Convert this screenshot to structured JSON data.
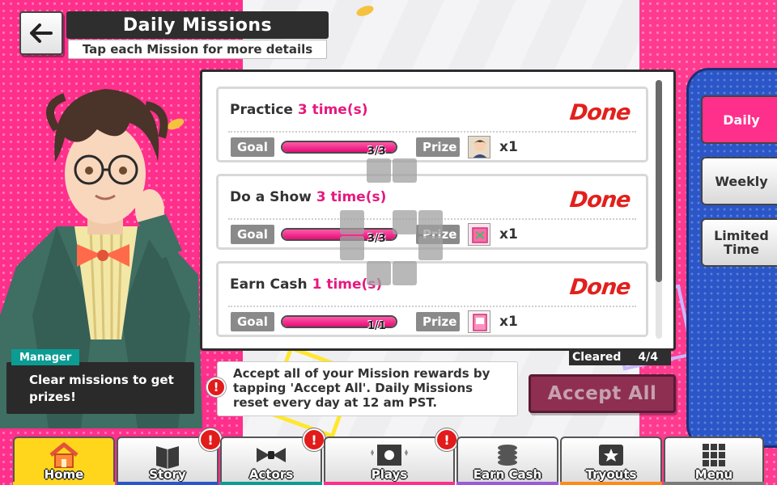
{
  "header": {
    "title": "Daily Missions",
    "subtitle": "Tap each Mission for more details"
  },
  "missions": [
    {
      "title": "Practice",
      "count": "3 time(s)",
      "status": "Done",
      "goal_label": "Goal",
      "progress_text": "3/3",
      "progress": 1.0,
      "prize_label": "Prize",
      "prize_icon": "character-portrait-icon",
      "prize_qty": "x1"
    },
    {
      "title": "Do a Show",
      "count": "3 time(s)",
      "status": "Done",
      "goal_label": "Goal",
      "progress_text": "3/3",
      "progress": 1.0,
      "prize_label": "Prize",
      "prize_icon": "ticket-card-icon",
      "prize_qty": "x1"
    },
    {
      "title": "Earn Cash",
      "count": "1 time(s)",
      "status": "Done",
      "goal_label": "Goal",
      "progress_text": "1/1",
      "progress": 1.0,
      "prize_label": "Prize",
      "prize_icon": "pink-card-icon",
      "prize_qty": "x1"
    }
  ],
  "cleared": {
    "label": "Cleared",
    "value": "4/4"
  },
  "info": {
    "text": "Accept all of your Mission rewards by tapping 'Accept All'. Daily Missions reset every day at 12 am PST."
  },
  "accept_all_label": "Accept All",
  "tabs": [
    {
      "label": "Daily",
      "active": true
    },
    {
      "label": "Weekly",
      "active": false
    },
    {
      "label": "Limited Time",
      "active": false
    }
  ],
  "manager": {
    "label": "Manager",
    "text": "Clear missions to get prizes!"
  },
  "nav": [
    {
      "label": "Home",
      "icon": "house-icon",
      "active": true,
      "badge": "",
      "strip": "#ffd61c"
    },
    {
      "label": "Story",
      "icon": "book-icon",
      "active": false,
      "badge": "!",
      "strip": "#2b56c8"
    },
    {
      "label": "Actors",
      "icon": "bowtie-icon",
      "active": false,
      "badge": "!",
      "strip": "#0b9c93"
    },
    {
      "label": "Plays",
      "icon": "theater-icon",
      "active": false,
      "badge": "!",
      "strip": "#ff2f8c"
    },
    {
      "label": "Earn Cash",
      "icon": "coins-icon",
      "active": false,
      "badge": "",
      "strip": "#9c5ad8"
    },
    {
      "label": "Tryouts",
      "icon": "star-ticket-icon",
      "active": false,
      "badge": "",
      "strip": "#ff8a1c"
    },
    {
      "label": "Menu",
      "icon": "grid-icon",
      "active": false,
      "badge": "",
      "strip": "#7a7a7a"
    }
  ],
  "colors": {
    "accent_pink": "#e6197f",
    "done_red": "#e2201c",
    "rail_blue": "#2b56c8",
    "manager_teal": "#0b9c93"
  }
}
